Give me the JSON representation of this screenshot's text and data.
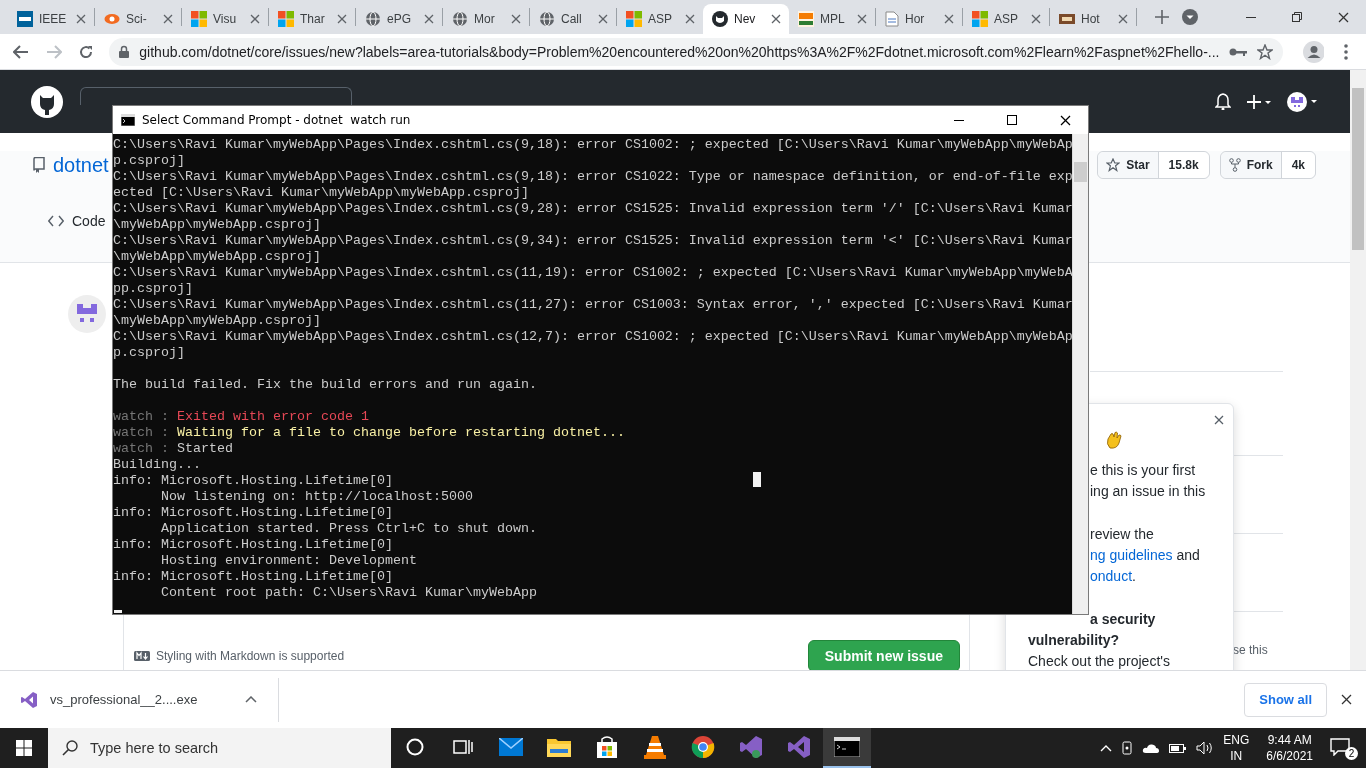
{
  "browser": {
    "tabs": [
      {
        "title": "IEEE",
        "kind": "ieee",
        "selected": false
      },
      {
        "title": "Sci-",
        "kind": "eye",
        "selected": false
      },
      {
        "title": "Visu",
        "kind": "squares",
        "selected": false
      },
      {
        "title": "Thar",
        "kind": "squares",
        "selected": false
      },
      {
        "title": "ePG",
        "kind": "globe",
        "selected": false
      },
      {
        "title": "Mor",
        "kind": "globe",
        "selected": false
      },
      {
        "title": "Call",
        "kind": "globe",
        "selected": false
      },
      {
        "title": "ASP",
        "kind": "squares",
        "selected": false
      },
      {
        "title": "Nev",
        "kind": "github",
        "selected": true
      },
      {
        "title": "MPL",
        "kind": "online",
        "selected": false
      },
      {
        "title": "Hor",
        "kind": "doc",
        "selected": false
      },
      {
        "title": "ASP",
        "kind": "squares",
        "selected": false
      },
      {
        "title": "Hot",
        "kind": "hot",
        "selected": false
      }
    ],
    "url": "github.com/dotnet/core/issues/new?labels=area-tutorials&body=Problem%20encountered%20on%20https%3A%2F%2Fdotnet.microsoft.com%2Flearn%2Faspnet%2Fhello-..."
  },
  "github": {
    "repo": {
      "owner": "dotnet",
      "tab": "Code",
      "star_label": "Star",
      "star_count": "15.8k",
      "fork_label": "Fork",
      "fork_count": "4k"
    },
    "form": {
      "markdown_note": "Styling with Markdown is supported",
      "submit": "Submit new issue"
    },
    "sidebar_note": "se this",
    "popup": {
      "groups": [
        [
          {
            "kind": "partial",
            "parts": [
              {
                "text": "e this is your first",
                "kind": "plain"
              }
            ]
          },
          {
            "kind": "partial",
            "parts": [
              {
                "text": "ing an issue in this",
                "kind": "plain"
              }
            ]
          }
        ],
        [
          {
            "kind": "partial",
            "parts": [
              {
                "text": "review the",
                "kind": "plain"
              }
            ]
          },
          {
            "kind": "partial",
            "parts": [
              {
                "text": "ng guidelines",
                "kind": "link"
              },
              {
                "text": " and",
                "kind": "plain"
              }
            ]
          },
          {
            "kind": "partial",
            "parts": [
              {
                "text": "onduct",
                "kind": "link"
              },
              {
                "text": ".",
                "kind": "plain"
              }
            ]
          }
        ],
        [
          {
            "kind": "partial",
            "parts": [
              {
                "text": "a security",
                "kind": "bold"
              }
            ]
          },
          {
            "kind": "whole",
            "parts": [
              {
                "text": "vulnerability?",
                "kind": "bold"
              }
            ]
          },
          {
            "kind": "whole",
            "parts": [
              {
                "text": "Check out the project's",
                "kind": "plain"
              }
            ]
          }
        ]
      ]
    }
  },
  "terminal": {
    "title": "Select Command Prompt - dotnet  watch run",
    "lines": [
      {
        "kind": "plain",
        "text": "C:\\Users\\Ravi Kumar\\myWebApp\\Pages\\Index.cshtml.cs(9,18): error CS1002: ; expected [C:\\Users\\Ravi Kumar\\myWebApp\\myWebAp"
      },
      {
        "kind": "plain",
        "text": "p.csproj]"
      },
      {
        "kind": "plain",
        "text": "C:\\Users\\Ravi Kumar\\myWebApp\\Pages\\Index.cshtml.cs(9,18): error CS1022: Type or namespace definition, or end-of-file exp"
      },
      {
        "kind": "plain",
        "text": "ected [C:\\Users\\Ravi Kumar\\myWebApp\\myWebApp.csproj]"
      },
      {
        "kind": "plain",
        "text": "C:\\Users\\Ravi Kumar\\myWebApp\\Pages\\Index.cshtml.cs(9,28): error CS1525: Invalid expression term '/' [C:\\Users\\Ravi Kumar"
      },
      {
        "kind": "plain",
        "text": "\\myWebApp\\myWebApp.csproj]"
      },
      {
        "kind": "plain",
        "text": "C:\\Users\\Ravi Kumar\\myWebApp\\Pages\\Index.cshtml.cs(9,34): error CS1525: Invalid expression term '<' [C:\\Users\\Ravi Kumar"
      },
      {
        "kind": "plain",
        "text": "\\myWebApp\\myWebApp.csproj]"
      },
      {
        "kind": "plain",
        "text": "C:\\Users\\Ravi Kumar\\myWebApp\\Pages\\Index.cshtml.cs(11,19): error CS1002: ; expected [C:\\Users\\Ravi Kumar\\myWebApp\\myWebA"
      },
      {
        "kind": "plain",
        "text": "pp.csproj]"
      },
      {
        "kind": "plain",
        "text": "C:\\Users\\Ravi Kumar\\myWebApp\\Pages\\Index.cshtml.cs(11,27): error CS1003: Syntax error, ',' expected [C:\\Users\\Ravi Kumar"
      },
      {
        "kind": "plain",
        "text": "\\myWebApp\\myWebApp.csproj]"
      },
      {
        "kind": "plain",
        "text": "C:\\Users\\Ravi Kumar\\myWebApp\\Pages\\Index.cshtml.cs(12,7): error CS1002: ; expected [C:\\Users\\Ravi Kumar\\myWebApp\\myWebAp"
      },
      {
        "kind": "plain",
        "text": "p.csproj]"
      },
      {
        "kind": "blank"
      },
      {
        "kind": "plain",
        "text": "The build failed. Fix the build errors and run again."
      },
      {
        "kind": "blank"
      },
      {
        "kind": "error",
        "prefix": "watch :",
        "text": "Exited with error code 1"
      },
      {
        "kind": "warning",
        "prefix": "watch :",
        "text": "Waiting for a file to change before restarting dotnet..."
      },
      {
        "kind": "plain",
        "prefix": "watch :",
        "text": "Started"
      },
      {
        "kind": "plain",
        "text": "Building..."
      },
      {
        "kind": "plain",
        "text": "info: Microsoft.Hosting.Lifetime[0]"
      },
      {
        "kind": "plain",
        "text": "      Now listening on: http://localhost:5000"
      },
      {
        "kind": "plain",
        "text": "info: Microsoft.Hosting.Lifetime[0]"
      },
      {
        "kind": "plain",
        "text": "      Application started. Press Ctrl+C to shut down."
      },
      {
        "kind": "plain",
        "text": "info: Microsoft.Hosting.Lifetime[0]"
      },
      {
        "kind": "plain",
        "text": "      Hosting environment: Development"
      },
      {
        "kind": "plain",
        "text": "info: Microsoft.Hosting.Lifetime[0]"
      },
      {
        "kind": "plain",
        "text": "      Content root path: C:\\Users\\Ravi Kumar\\myWebApp"
      }
    ]
  },
  "download": {
    "file": "vs_professional__2....exe",
    "show_all": "Show all"
  },
  "taskbar": {
    "search_placeholder": "Type here to search",
    "apps": [
      {
        "kind": "cortana",
        "active": false
      },
      {
        "kind": "taskview",
        "active": false
      },
      {
        "kind": "mail",
        "active": false
      },
      {
        "kind": "folder",
        "active": false
      },
      {
        "kind": "store",
        "active": false
      },
      {
        "kind": "cone",
        "active": false
      },
      {
        "kind": "chrome",
        "active": false
      },
      {
        "kind": "vs-installer",
        "active": false
      },
      {
        "kind": "vs",
        "active": false
      },
      {
        "kind": "console",
        "active": true
      }
    ],
    "language": "ENG",
    "region": "IN",
    "time": "9:44 AM",
    "date": "6/6/2021",
    "notifications": "2"
  }
}
